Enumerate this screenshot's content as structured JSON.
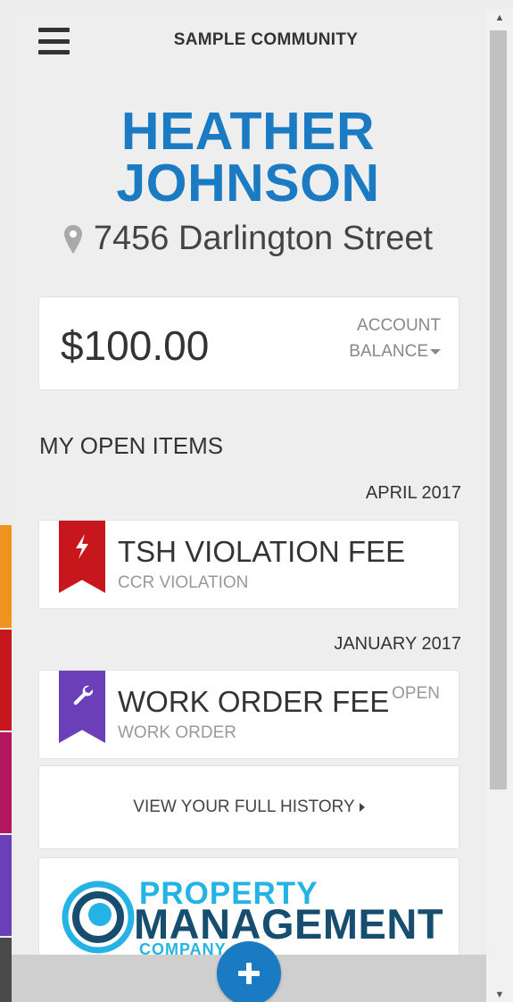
{
  "header": {
    "community": "SAMPLE COMMUNITY",
    "menu_icon": "hamburger-menu-icon"
  },
  "resident": {
    "name_line1": "HEATHER",
    "name_line2": "JOHNSON",
    "address": "7456 Darlington Street",
    "address_icon": "map-pin-icon"
  },
  "balance": {
    "amount": "$100.00",
    "label_line1": "ACCOUNT",
    "label_line2": "BALANCE"
  },
  "open_items": {
    "title": "MY OPEN ITEMS",
    "groups": [
      {
        "month": "APRIL 2017",
        "items": [
          {
            "title": "TSH VIOLATION FEE",
            "subtitle": "CCR VIOLATION",
            "status": "",
            "icon": "lightning-bolt-icon",
            "color": "#c8171c"
          }
        ]
      },
      {
        "month": "JANUARY 2017",
        "items": [
          {
            "title": "WORK ORDER FEE",
            "subtitle": "WORK ORDER",
            "status": "OPEN",
            "icon": "wrench-icon",
            "color": "#6b3fb8"
          }
        ]
      }
    ]
  },
  "history": {
    "label": "VIEW YOUR FULL HISTORY"
  },
  "logo": {
    "line1": "PROPERTY",
    "line2": "MANAGEMENT",
    "line3": "COMPANY"
  },
  "fab": {
    "icon": "plus-icon"
  },
  "colors": {
    "accent": "#1a7bc2",
    "stripes": [
      "#f1941f",
      "#c8171c",
      "#b3155f",
      "#6b3fb8",
      "#4a4a4a"
    ]
  }
}
